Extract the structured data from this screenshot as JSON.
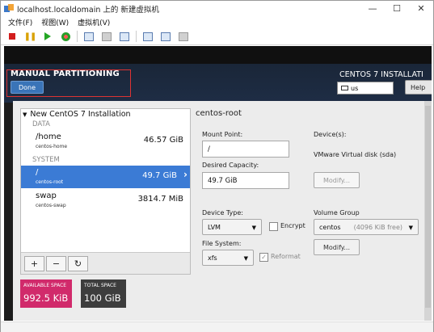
{
  "window": {
    "title": "localhost.localdomain 上的 新建虚拟机",
    "min_glyph": "—",
    "max_glyph": "☐",
    "close_glyph": "✕"
  },
  "menu": [
    "文件(F)",
    "视图(W)",
    "虚拟机(V)"
  ],
  "toolbar_icons": [
    "power-off-icon",
    "pause-icon",
    "play-icon",
    "reset-icon",
    "snapshot-icon",
    "revert-icon",
    "manage-snapshots-icon",
    "fullscreen-icon",
    "unity-icon",
    "settings-icon"
  ],
  "header": {
    "title": "MANUAL PARTITIONING",
    "done_label": "Done",
    "right_title": "CENTOS 7 INSTALLATI",
    "keyboard_layout": "us",
    "help_label": "Help"
  },
  "tree": {
    "installation_label": "New CentOS 7 Installation",
    "sections": [
      {
        "name": "DATA",
        "items": [
          {
            "name": "/home",
            "device": "centos-home",
            "size": "46.57 GiB",
            "selected": false
          }
        ]
      },
      {
        "name": "SYSTEM",
        "items": [
          {
            "name": "/",
            "device": "centos-root",
            "size": "49.7 GiB",
            "selected": true
          },
          {
            "name": "swap",
            "device": "centos-swap",
            "size": "3814.7 MiB",
            "selected": false
          }
        ]
      }
    ],
    "controls": {
      "add": "+",
      "remove": "−",
      "reset": "↻"
    }
  },
  "space": {
    "available_label": "AVAILABLE SPACE",
    "available_value": "992.5 KiB",
    "available_color": "#d12a6b",
    "total_label": "TOTAL SPACE",
    "total_value": "100 GiB",
    "total_color": "#3d3d3d"
  },
  "detail": {
    "title": "centos-root",
    "mount_point_label": "Mount Point:",
    "mount_point_value": "/",
    "desired_capacity_label": "Desired Capacity:",
    "desired_capacity_value": "49.7 GiB",
    "devices_label": "Device(s):",
    "devices_value": "VMware Virtual disk (sda)",
    "modify_devices_label": "Modify...",
    "device_type_label": "Device Type:",
    "device_type_value": "LVM",
    "encrypt_label": "Encrypt",
    "encrypt_checked": false,
    "volume_group_label": "Volume Group",
    "volume_group_name": "centos",
    "volume_group_free": "(4096 KiB free)",
    "modify_vg_label": "Modify...",
    "file_system_label": "File System:",
    "file_system_value": "xfs",
    "reformat_label": "Reformat",
    "reformat_checked": true
  },
  "colors": {
    "accent": "#3b7bd5",
    "header_bg": "#1e2d45",
    "highlight_box": "#dd3333"
  }
}
